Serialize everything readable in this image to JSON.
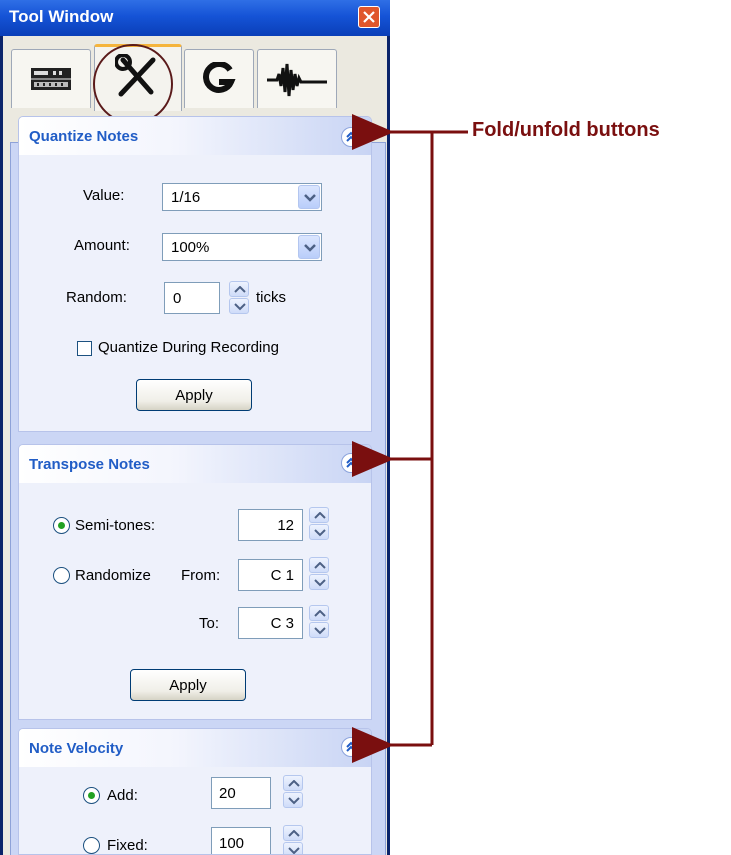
{
  "window": {
    "title": "Tool Window"
  },
  "tabs": [
    {
      "name": "mixer",
      "icon": "mixer-icon"
    },
    {
      "name": "tools",
      "icon": "wrench-screwdriver-icon",
      "active": true
    },
    {
      "name": "groove",
      "icon": "groove-icon"
    },
    {
      "name": "audio",
      "icon": "waveform-icon"
    }
  ],
  "quantize": {
    "title": "Quantize Notes",
    "value_label": "Value:",
    "value": "1/16",
    "amount_label": "Amount:",
    "amount": "100%",
    "random_label": "Random:",
    "random_value": "0",
    "random_unit": "ticks",
    "during_recording_label": "Quantize During Recording",
    "during_recording_checked": false,
    "apply_label": "Apply"
  },
  "transpose": {
    "title": "Transpose Notes",
    "semitones_label": "Semi-tones:",
    "semitones_value": "12",
    "semitones_selected": true,
    "randomize_label": "Randomize",
    "from_label": "From:",
    "from_value": "C 1",
    "to_label": "To:",
    "to_value": "C 3",
    "apply_label": "Apply"
  },
  "velocity": {
    "title": "Note Velocity",
    "add_label": "Add:",
    "add_value": "20",
    "add_selected": true,
    "fixed_label": "Fixed:",
    "fixed_value": "100"
  },
  "annotation": {
    "label": "Fold/unfold buttons",
    "color": "#7a0f0f"
  }
}
